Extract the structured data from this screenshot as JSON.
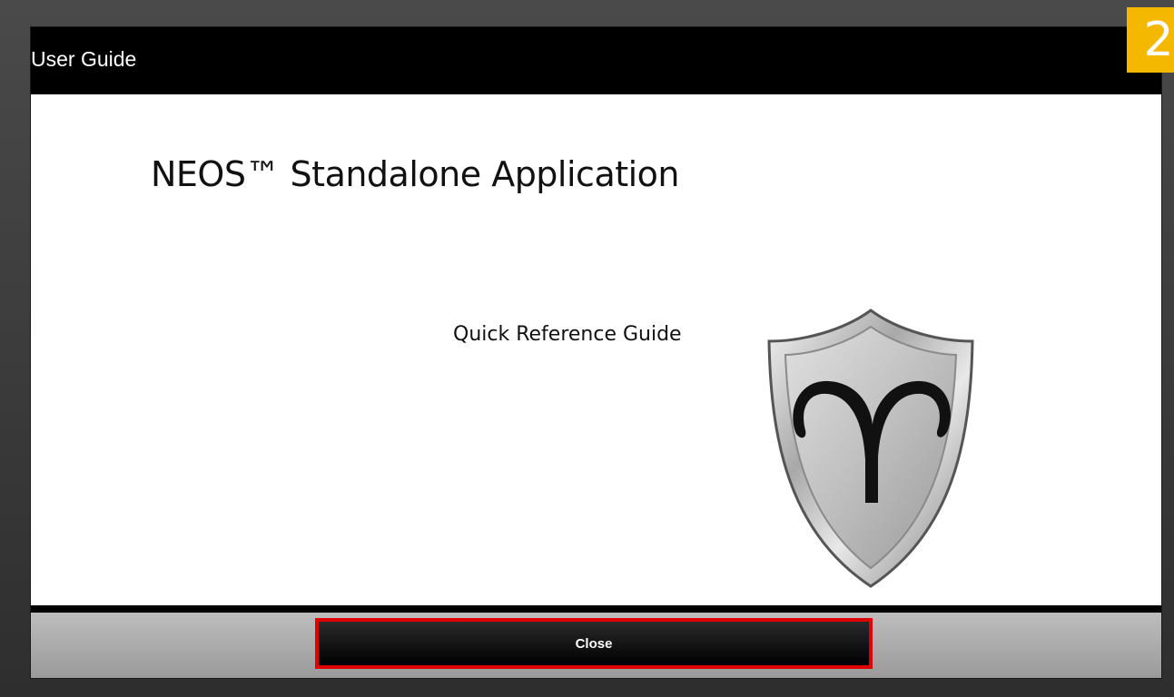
{
  "dialog": {
    "title": "User Guide",
    "step_badge": "2"
  },
  "document": {
    "title": "NEOS™ Standalone Application",
    "subtitle": "Quick Reference Guide",
    "logo_icon": "aries-shield-icon"
  },
  "footer": {
    "close_label": "Close"
  },
  "colors": {
    "titlebar": "#000000",
    "badge": "#f5b800",
    "close_border": "#e00000"
  }
}
